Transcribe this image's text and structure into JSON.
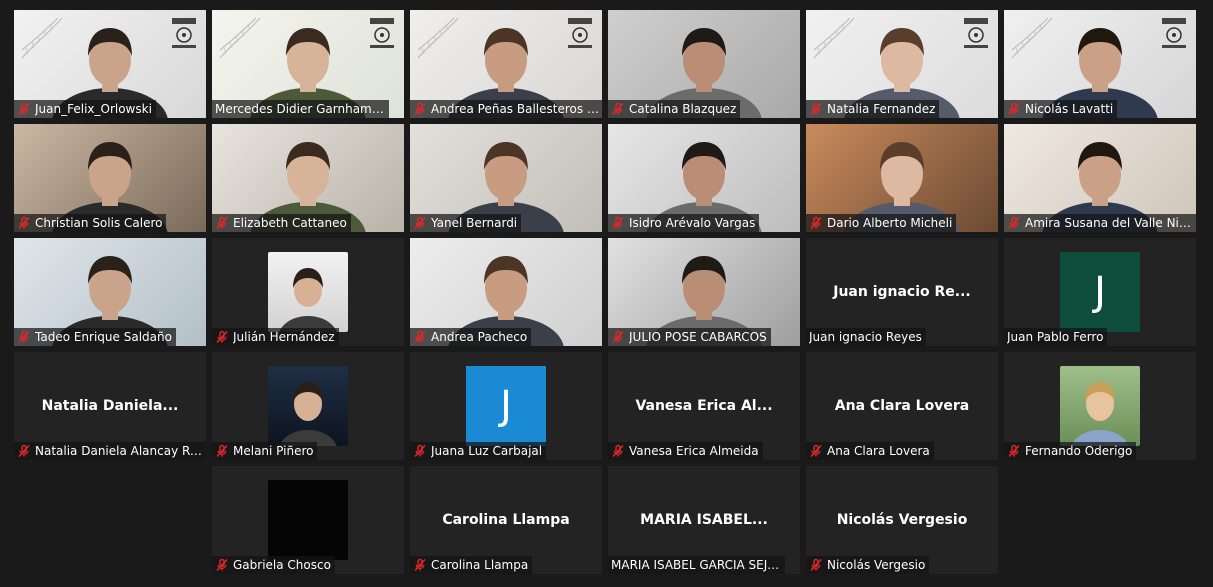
{
  "participants": [
    {
      "name": "Juan_Felix_Orlowski",
      "muted": true,
      "video": true
    },
    {
      "name": "Mercedes Didier Garnham | R...",
      "muted": false,
      "video": true,
      "active": true
    },
    {
      "name": "Andrea Peñas Ballesteros - RS...",
      "muted": true,
      "video": true
    },
    {
      "name": "Catalina Blazquez",
      "muted": true,
      "video": true
    },
    {
      "name": "Natalia Fernandez",
      "muted": true,
      "video": true
    },
    {
      "name": "Nicolás Lavatti",
      "muted": true,
      "video": true
    },
    {
      "name": "Christian Solis Calero",
      "muted": true,
      "video": true
    },
    {
      "name": "Elizabeth Cattaneo",
      "muted": true,
      "video": true
    },
    {
      "name": "Yanel Bernardi",
      "muted": true,
      "video": true
    },
    {
      "name": "Isidro Arévalo Vargas",
      "muted": true,
      "video": true
    },
    {
      "name": "Dario Alberto Micheli",
      "muted": true,
      "video": true
    },
    {
      "name": "Amira Susana del Valle Nie...",
      "muted": true,
      "video": true
    },
    {
      "name": "Tadeo Enrique Saldaño",
      "muted": true,
      "video": true
    },
    {
      "name": "Julián Hernández",
      "muted": true,
      "video": false,
      "photo": true
    },
    {
      "name": "Andrea Pacheco",
      "muted": true,
      "video": true
    },
    {
      "name": "JULIO POSE CABARCOS",
      "muted": true,
      "video": true
    },
    {
      "name": "Juan ignacio Reyes",
      "muted": false,
      "video": false,
      "display": "Juan ignacio Re..."
    },
    {
      "name": "Juan Pablo Ferro",
      "muted": false,
      "video": false,
      "letter": "J",
      "letter_bg": "#0d4d3a"
    },
    {
      "name": "Natalia Daniela Alancay Ro...",
      "muted": true,
      "video": false,
      "display": "Natalia Daniela..."
    },
    {
      "name": "Melani Piñero",
      "muted": true,
      "video": false,
      "photo": true
    },
    {
      "name": "Juana Luz Carbajal",
      "muted": true,
      "video": false,
      "letter": "J",
      "letter_bg": "#1a8ad4"
    },
    {
      "name": "Vanesa Erica Almeida",
      "muted": true,
      "video": false,
      "display": "Vanesa Erica Al..."
    },
    {
      "name": "Ana Clara Lovera",
      "muted": true,
      "video": false,
      "display": "Ana Clara Lovera"
    },
    {
      "name": "Fernando Oderigo",
      "muted": true,
      "video": false,
      "photo": true
    },
    {
      "name": "Gabriela Chosco",
      "muted": true,
      "video": false,
      "photo": true,
      "photo_black": true
    },
    {
      "name": "Carolina Llampa",
      "muted": true,
      "video": false,
      "display": "Carolina Llampa"
    },
    {
      "name": "MARIA ISABEL GARCIA SEJAS",
      "muted": false,
      "video": false,
      "display": "MARIA ISABEL..."
    },
    {
      "name": "Nicolás Vergesio",
      "muted": true,
      "video": false,
      "display": "Nicolás Vergesio"
    }
  ],
  "colors": {
    "background": "#1a1a1a",
    "tile": "#232323",
    "active_border": "#cfe07a",
    "mute": "#e02828"
  },
  "icons": {
    "mute": "microphone-muted-icon"
  }
}
